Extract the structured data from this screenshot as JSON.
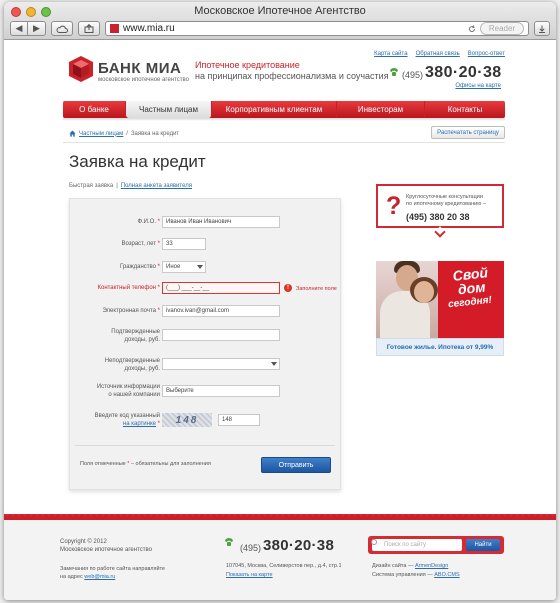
{
  "browser": {
    "title": "Московское Ипотечное Агентство",
    "url": "www.mia.ru",
    "reader": "Reader"
  },
  "header": {
    "logo_name": "БАНК МИА",
    "logo_sub": "московское ипотечное агентство",
    "slogan_1": "Ипотечное кредитование",
    "slogan_2": "на принципах профессионализма и соучастия",
    "top_links": [
      "Карта сайта",
      "Обратная связь",
      "Вопрос-ответ"
    ],
    "phone_code": "(495)",
    "phone_number": "380·20·38",
    "offices_link": "Офисы на карте"
  },
  "menu": [
    "О банке",
    "Частным лицам",
    "Корпоративным клиентам",
    "Инвесторам",
    "Контакты"
  ],
  "breadcrumb": {
    "item_1": "Частным лицам",
    "sep": "/",
    "current": "Заявка на кредит"
  },
  "print_button": "Распечатать страницу",
  "page_title": "Заявка на кредит",
  "form_tabs": {
    "active": "Быстрая заявка",
    "sep": "|",
    "other": "Полная анкета заявителя"
  },
  "form": {
    "fio": {
      "label": "Ф.И.О.",
      "value": "Иванов Иван Иванович"
    },
    "age": {
      "label": "Возраст, лет",
      "value": "33"
    },
    "citizenship": {
      "label": "Гражданство",
      "value": "Иное"
    },
    "phone": {
      "label": "Контактный телефон",
      "value": "(___) ___-__-__",
      "error": "Заполните поле"
    },
    "email": {
      "label": "Электронная почта",
      "value": "ivanov.ivan@gmail.com"
    },
    "confirmed_income": {
      "label_1": "Подтвержденные",
      "label_2": "доходы, руб.",
      "value": ""
    },
    "unconfirmed_income": {
      "label_1": "Неподтвержденные",
      "label_2": "доходы, руб.",
      "value": ""
    },
    "source": {
      "label_1": "Источник информации",
      "label_2": "о нашей компании",
      "value": "Выберите"
    },
    "captcha": {
      "label_1": "Введите код указанный",
      "label_2": "на картинке",
      "image_text": "148",
      "value": "148"
    },
    "required_mark": "*",
    "note_prefix": "Поля отмеченные",
    "note_suffix": "– обязательны для заполнения",
    "submit": "Отправить"
  },
  "consult": {
    "icon": "?",
    "text_1": "Круглосуточные консультации",
    "text_2": "по ипотечному кредитованию –",
    "phone": "(495) 380 20 38"
  },
  "banner": {
    "headline_1": "Свой",
    "headline_2": "дом",
    "headline_3": "сегодня!",
    "caption": "Готовое жилье. Ипотека от 9,99%"
  },
  "footer": {
    "copyright": "Copyright © 2012",
    "company": "Московское ипотечное агентство",
    "mail_text_1": "Замечания по работе сайта направляйте",
    "mail_text_2": "на адрес",
    "mail_link": "web@mia.ru",
    "phone_code": "(495)",
    "phone_number": "380·20·38",
    "address": "107045, Москва, Селиверстов пер., д.4, стр.1",
    "map_link": "Показать на карте",
    "search_placeholder": "Поиск по сайту",
    "search_button": "Найти",
    "design_label": "Дизайн сайта —",
    "design_link": "ArmenDesign",
    "cms_label": "Система управления —",
    "cms_link": "ABO.CMS"
  },
  "colors": {
    "brand_red": "#c8232c",
    "link_blue": "#2a6db0",
    "button_blue": "#1e55a1"
  }
}
